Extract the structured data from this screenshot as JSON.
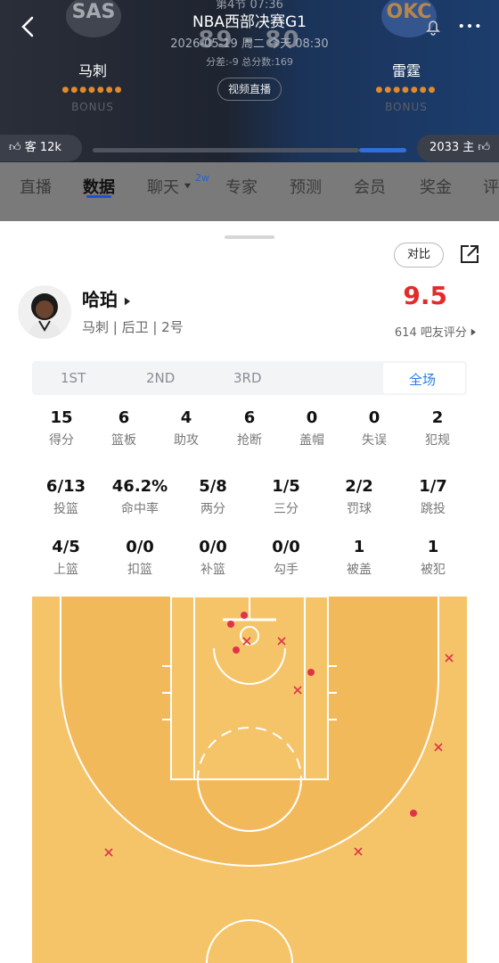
{
  "header": {
    "quarter": "第4节 07:36",
    "title": "NBA西部决赛G1",
    "score": "89 - 80",
    "date": "2026-05-19 周二 今天 08:30",
    "diff_info": "分差:-9 总分数:169",
    "live_label": "视频直播",
    "home_team": {
      "abbr": "SAS",
      "name": "马刺",
      "dots": "●●●●●●●",
      "bonus": "BONUS"
    },
    "away_team": {
      "abbr": "OKC",
      "name": "雷霆",
      "dots": "●●●●●●●",
      "bonus": "BONUS"
    },
    "cheer_left": "客 12k",
    "cheer_right": "2033 主",
    "cheer_ratio": 0.85
  },
  "tabs": [
    {
      "label": "直播"
    },
    {
      "label": "数据",
      "active": true
    },
    {
      "label": "聊天",
      "badge": "2w"
    },
    {
      "label": "专家"
    },
    {
      "label": "预测"
    },
    {
      "label": "会员"
    },
    {
      "label": "奖金"
    },
    {
      "label": "评"
    }
  ],
  "sheet": {
    "compare_label": "对比",
    "player": {
      "name": "哈珀",
      "meta": "马刺 | 后卫 | 2号",
      "rating": "9.5",
      "voters": "614 吧友评分"
    },
    "quarters": [
      "1ST",
      "2ND",
      "3RD",
      "全场"
    ],
    "selected_quarter": "全场",
    "stats_row1": [
      {
        "value": "15",
        "label": "得分"
      },
      {
        "value": "6",
        "label": "篮板"
      },
      {
        "value": "4",
        "label": "助攻"
      },
      {
        "value": "6",
        "label": "抢断"
      },
      {
        "value": "0",
        "label": "盖帽"
      },
      {
        "value": "0",
        "label": "失误"
      },
      {
        "value": "2",
        "label": "犯规"
      }
    ],
    "stats_row2": [
      {
        "value": "6/13",
        "label": "投篮"
      },
      {
        "value": "46.2%",
        "label": "命中率"
      },
      {
        "value": "5/8",
        "label": "两分"
      },
      {
        "value": "1/5",
        "label": "三分"
      },
      {
        "value": "2/2",
        "label": "罚球"
      },
      {
        "value": "1/7",
        "label": "跳投"
      }
    ],
    "stats_row3": [
      {
        "value": "4/5",
        "label": "上篮"
      },
      {
        "value": "0/0",
        "label": "扣篮"
      },
      {
        "value": "0/0",
        "label": "补篮"
      },
      {
        "value": "0/0",
        "label": "勾手"
      },
      {
        "value": "1",
        "label": "被盖"
      },
      {
        "value": "1",
        "label": "被犯"
      }
    ]
  },
  "colors": {
    "accent": "#2c7be5",
    "rating": "#e32b2b",
    "made": "#e0334a",
    "court": "#f5c469"
  }
}
